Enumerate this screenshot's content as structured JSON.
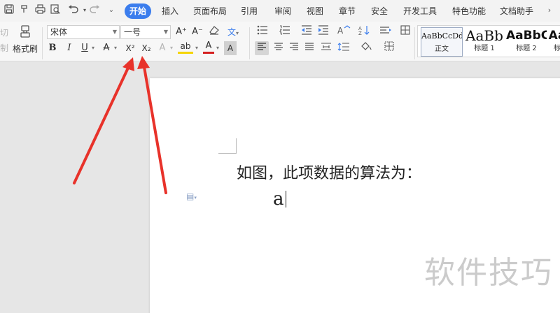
{
  "quick_access": {
    "save_icon": "save-icon",
    "format_painter_small_icon": "paint-icon",
    "print_icon": "print-icon",
    "preview_icon": "preview-icon",
    "undo_icon": "undo-icon",
    "redo_icon": "redo-icon",
    "customize_icon": "chevron-down-icon"
  },
  "menu": {
    "tabs": [
      {
        "label": "开始",
        "active": true
      },
      {
        "label": "插入"
      },
      {
        "label": "页面布局"
      },
      {
        "label": "引用"
      },
      {
        "label": "审阅"
      },
      {
        "label": "视图"
      },
      {
        "label": "章节"
      },
      {
        "label": "安全"
      },
      {
        "label": "开发工具"
      },
      {
        "label": "特色功能"
      },
      {
        "label": "文档助手"
      }
    ]
  },
  "ribbon": {
    "cut_label": "切",
    "copy_label": "制",
    "format_painter_label": "格式刷",
    "font_name": "宋体",
    "font_size": "一号",
    "grow_font": "A⁺",
    "shrink_font": "A⁻",
    "bold": "B",
    "italic": "I",
    "underline": "U",
    "strikethrough": "A",
    "superscript": "X²",
    "subscript": "X₂",
    "text_effect": "A",
    "highlight": "ab",
    "font_color": "A",
    "char_shading": "A",
    "phonetic": "文",
    "styles": [
      {
        "sample": "AaBbCcDd",
        "name": "正文",
        "selected": true
      },
      {
        "sample": "AaBb",
        "name": "标题 1"
      },
      {
        "sample": "AaBbC",
        "name": "标题 2"
      },
      {
        "sample": "Aa",
        "name": "标"
      }
    ]
  },
  "document": {
    "line1": "如图，此项数据的算法为：",
    "line2": "a"
  },
  "watermark": "软件技巧",
  "colors": {
    "accent": "#3b7ded",
    "arrow": "#e8322a",
    "highlight": "#f5d400",
    "font_color": "#d42020"
  }
}
